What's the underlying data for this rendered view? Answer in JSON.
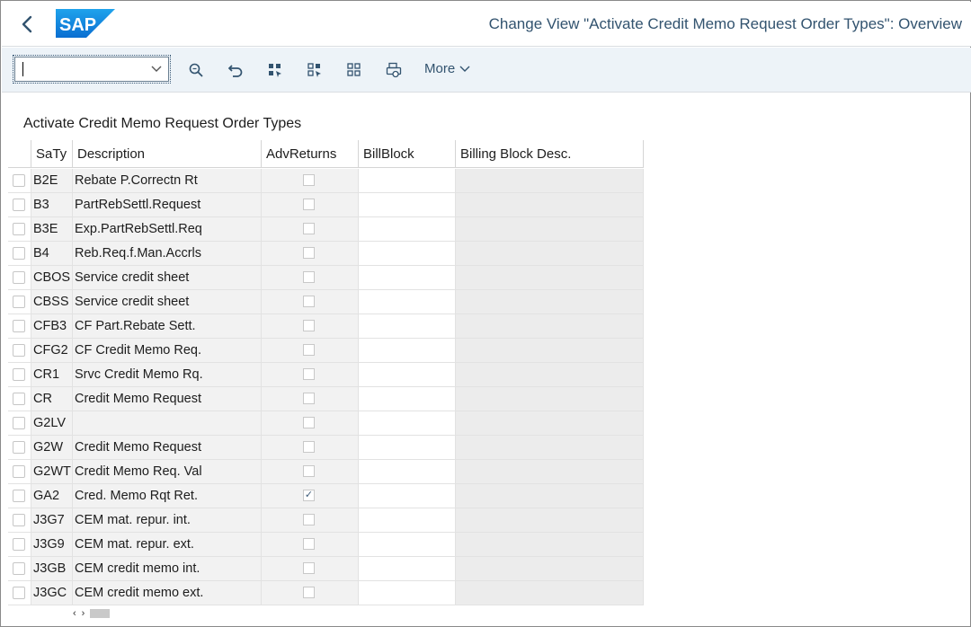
{
  "header": {
    "title": "Change View \"Activate Credit Memo Request Order Types\": Overview",
    "logo_text": "SAP",
    "brand_color": "#1a73c8"
  },
  "toolbar": {
    "command_field_value": "",
    "more_label": "More",
    "icons": [
      "find-icon",
      "undo-icon",
      "select-all-icon",
      "deselect-all-icon",
      "select-block-icon",
      "print-icon"
    ]
  },
  "section": {
    "title": "Activate Credit Memo Request Order Types"
  },
  "table": {
    "columns": [
      "SaTy",
      "Description",
      "AdvReturns",
      "BillBlock",
      "Billing Block Desc."
    ],
    "rows": [
      {
        "saty": "B2E",
        "desc": "Rebate P.Correctn Rt",
        "adv": false,
        "bill": "",
        "bdesc": ""
      },
      {
        "saty": "B3",
        "desc": "PartRebSettl.Request",
        "adv": false,
        "bill": "",
        "bdesc": ""
      },
      {
        "saty": "B3E",
        "desc": "Exp.PartRebSettl.Req",
        "adv": false,
        "bill": "",
        "bdesc": ""
      },
      {
        "saty": "B4",
        "desc": "Reb.Req.f.Man.Accrls",
        "adv": false,
        "bill": "",
        "bdesc": ""
      },
      {
        "saty": "CBOS",
        "desc": "Service credit sheet",
        "adv": false,
        "bill": "",
        "bdesc": ""
      },
      {
        "saty": "CBSS",
        "desc": "Service credit sheet",
        "adv": false,
        "bill": "",
        "bdesc": ""
      },
      {
        "saty": "CFB3",
        "desc": "CF Part.Rebate Sett.",
        "adv": false,
        "bill": "",
        "bdesc": ""
      },
      {
        "saty": "CFG2",
        "desc": "CF Credit Memo Req.",
        "adv": false,
        "bill": "",
        "bdesc": ""
      },
      {
        "saty": "CR1",
        "desc": "Srvc Credit Memo Rq.",
        "adv": false,
        "bill": "",
        "bdesc": ""
      },
      {
        "saty": "CR",
        "desc": "Credit Memo Request",
        "adv": false,
        "bill": "",
        "bdesc": ""
      },
      {
        "saty": "G2LV",
        "desc": "",
        "adv": false,
        "bill": "",
        "bdesc": ""
      },
      {
        "saty": "G2W",
        "desc": "Credit Memo Request",
        "adv": false,
        "bill": "",
        "bdesc": ""
      },
      {
        "saty": "G2WT",
        "desc": "Credit Memo Req. Val",
        "adv": false,
        "bill": "",
        "bdesc": ""
      },
      {
        "saty": "GA2",
        "desc": "Cred. Memo Rqt Ret.",
        "adv": true,
        "bill": "",
        "bdesc": ""
      },
      {
        "saty": "J3G7",
        "desc": "CEM mat. repur. int.",
        "adv": false,
        "bill": "",
        "bdesc": ""
      },
      {
        "saty": "J3G9",
        "desc": "CEM mat. repur. ext.",
        "adv": false,
        "bill": "",
        "bdesc": ""
      },
      {
        "saty": "J3GB",
        "desc": "CEM credit memo int.",
        "adv": false,
        "bill": "",
        "bdesc": ""
      },
      {
        "saty": "J3GC",
        "desc": "CEM credit memo ext.",
        "adv": false,
        "bill": "",
        "bdesc": ""
      }
    ]
  }
}
